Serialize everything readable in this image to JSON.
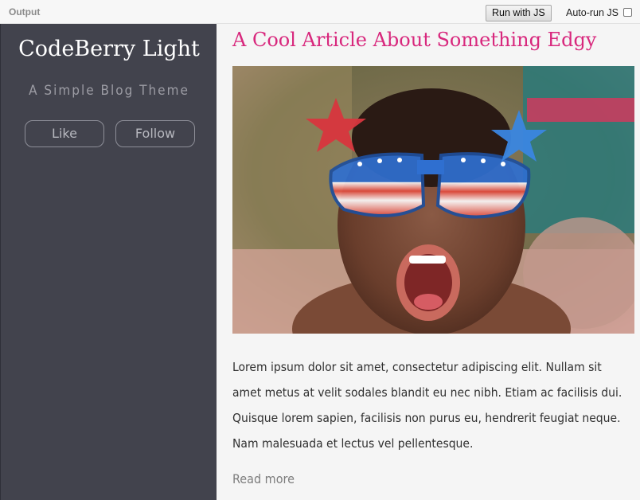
{
  "output_bar": {
    "label": "Output",
    "run_button": "Run with JS",
    "autorun_label": "Auto-run JS"
  },
  "sidebar": {
    "title": "CodeBerry Light",
    "subtitle": "A Simple Blog Theme",
    "like_label": "Like",
    "follow_label": "Follow"
  },
  "article": {
    "title": "A Cool Article About Something Edgy",
    "body": "Lorem ipsum dolor sit amet, consectetur adipiscing elit. Nullam sit amet metus at velit sodales blandit eu nec nibh. Etiam ac facilisis dui. Quisque lorem sapien, facilisis non purus eu, hendrerit feugiat neque. Nam malesuada et lectus vel pellentesque.",
    "read_more": "Read more"
  },
  "colors": {
    "sidebar_bg": "#42434d",
    "accent_title": "#d8287d",
    "page_bg": "#f5f5f5"
  }
}
